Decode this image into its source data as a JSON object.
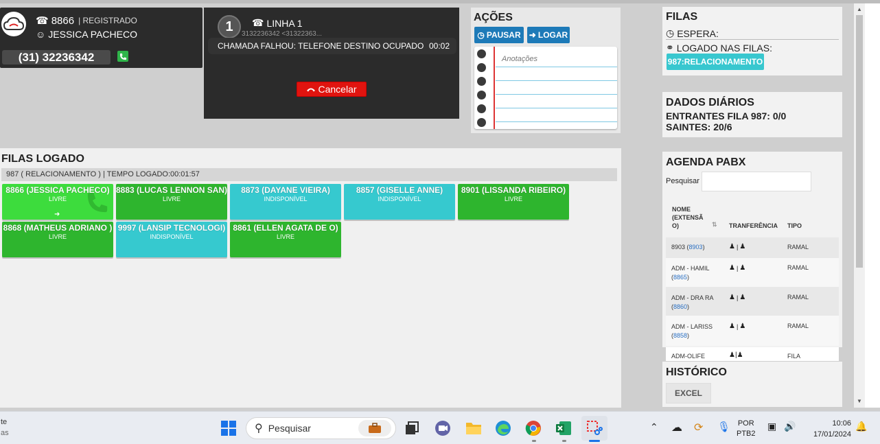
{
  "agent": {
    "extension": "8866",
    "status": "REGISTRADO",
    "name": "JESSICA PACHECO",
    "phone": "(31) 32236342"
  },
  "line": {
    "number": "1",
    "label": "LINHA 1",
    "subtitle": "3132236342 <31322363...",
    "status_text": "CHAMADA FALHOU: TELEFONE DESTINO OCUPADO",
    "timer": "00:02",
    "cancel_label": "Cancelar"
  },
  "acoes": {
    "title": "AÇÕES",
    "pause_label": "PAUSAR",
    "login_label": "LOGAR",
    "notes_placeholder": "Anotações"
  },
  "filas": {
    "title": "FILAS",
    "espera_label": "ESPERA:",
    "logado_label": "LOGADO NAS FILAS:",
    "queue_badge": "987:RELACIONAMENTO"
  },
  "dados": {
    "title": "DADOS DIÁRIOS",
    "entrantes": "ENTRANTES FILA 987: 0/0",
    "saintes": "SAINTES: 20/6"
  },
  "agenda": {
    "title": "AGENDA PABX",
    "search_label": "Pesquisar",
    "columns": [
      "NOME (EXTENSÃ O)",
      "TRANFERÊNCIA",
      "TIPO"
    ],
    "rows": [
      {
        "name": "8903",
        "ext": "8903",
        "type": "RAMAL"
      },
      {
        "name": "ADM - HAMIL",
        "ext": "8865",
        "type": "RAMAL"
      },
      {
        "name": "ADM - DRA RA",
        "ext": "8860",
        "type": "RAMAL"
      },
      {
        "name": "ADM - LARISS",
        "ext": "8858",
        "type": "RAMAL"
      },
      {
        "name": "ADM-OLIFE",
        "ext": "",
        "type": "FILA"
      }
    ]
  },
  "historico": {
    "title": "HISTÓRICO",
    "excel_label": "EXCEL"
  },
  "filas_logado": {
    "title": "FILAS LOGADO",
    "info": "987 ( RELACIONAMENTO ) | TEMPO LOGADO:00:01:57",
    "agents": [
      {
        "label": "8866 (JESSICA PACHECO)",
        "status": "LIVRE",
        "color": "#3ddc3d"
      },
      {
        "label": "8883 (LUCAS LENNON SAN)",
        "status": "LIVRE",
        "color": "#2eb52e"
      },
      {
        "label": "8873 (DAYANE VIEIRA)",
        "status": "INDISPONÍVEL",
        "color": "#36c9cf"
      },
      {
        "label": "8857 (GISELLE ANNE)",
        "status": "INDISPONÍVEL",
        "color": "#36c9cf"
      },
      {
        "label": "8901 (LISSANDA RIBEIRO)",
        "status": "LIVRE",
        "color": "#2eb52e"
      },
      {
        "label": "8868 (MATHEUS ADRIANO )",
        "status": "LIVRE",
        "color": "#2eb52e"
      },
      {
        "label": "9997 (LANSIP TECNOLOGI)",
        "status": "INDISPONÍVEL",
        "color": "#36c9cf"
      },
      {
        "label": "8861 (ELLEN AGATA DE O)",
        "status": "LIVRE",
        "color": "#2eb52e"
      }
    ]
  },
  "taskbar": {
    "left_text_1": "te",
    "left_text_2": "as",
    "search_placeholder": "Pesquisar",
    "lang_1": "POR",
    "lang_2": "PTB2",
    "time": "10:06",
    "date": "17/01/2024"
  }
}
